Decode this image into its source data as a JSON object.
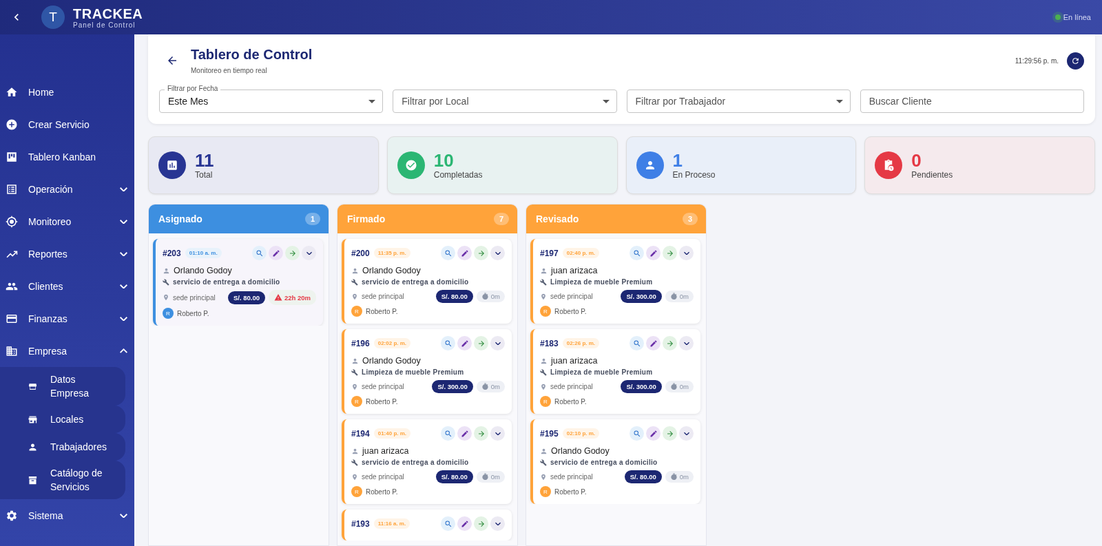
{
  "topbar": {
    "avatar_letter": "T",
    "brand": "TRACKEA",
    "subtitle": "Panel de Control",
    "status": {
      "label": "En línea",
      "online": true
    }
  },
  "sidebar": {
    "items": [
      {
        "label": "Home",
        "kind": "link"
      },
      {
        "label": "Crear Servicio",
        "kind": "link"
      },
      {
        "label": "Tablero Kanban",
        "kind": "link"
      },
      {
        "label": "Operación",
        "kind": "group",
        "expanded": false
      },
      {
        "label": "Monitoreo",
        "kind": "group",
        "expanded": false
      },
      {
        "label": "Reportes",
        "kind": "group",
        "expanded": false
      },
      {
        "label": "Clientes",
        "kind": "group",
        "expanded": false
      },
      {
        "label": "Finanzas",
        "kind": "group",
        "expanded": false
      },
      {
        "label": "Empresa",
        "kind": "group",
        "expanded": true,
        "children": [
          {
            "label": "Datos Empresa"
          },
          {
            "label": "Locales"
          },
          {
            "label": "Trabajadores"
          },
          {
            "label": "Catálogo de Servicios"
          }
        ]
      },
      {
        "label": "Sistema",
        "kind": "group",
        "expanded": false
      }
    ]
  },
  "header": {
    "title": "Tablero de Control",
    "subtitle": "Monitoreo en tiempo real",
    "time": "11:29:56 p. m.",
    "filters": [
      {
        "kind": "select",
        "label": "Filtrar por Fecha",
        "value": "Este Mes"
      },
      {
        "kind": "select",
        "placeholder": "Filtrar por Local"
      },
      {
        "kind": "select",
        "placeholder": "Filtrar por Trabajador"
      },
      {
        "kind": "search",
        "placeholder": "Buscar Cliente"
      }
    ]
  },
  "stats": [
    {
      "value": "11",
      "label": "Total",
      "color": "#283593"
    },
    {
      "value": "10",
      "label": "Completadas",
      "color": "#2bb673"
    },
    {
      "value": "1",
      "label": "En Proceso",
      "color": "#3f7fe6"
    },
    {
      "value": "0",
      "label": "Pendientes",
      "color": "#e53945"
    }
  ],
  "columns": [
    {
      "title": "Asignado",
      "count": "1",
      "color": "#3d8fe0",
      "cards": [
        {
          "id": "#203",
          "time": "01:10 a. m.",
          "client": "Orlando Godoy",
          "service": "servicio de entrega a domicilio",
          "location": "sede principal",
          "price": "S/. 80.00",
          "timer": {
            "kind": "alert",
            "text": "22h 20m"
          },
          "worker_initial": "R",
          "worker": "Roberto P."
        }
      ]
    },
    {
      "title": "Firmado",
      "count": "7",
      "color": "#ffa33a",
      "cards": [
        {
          "id": "#200",
          "time": "11:35 p. m.",
          "client": "Orlando Godoy",
          "service": "servicio de entrega a domicilio",
          "location": "sede principal",
          "price": "S/. 80.00",
          "timer": {
            "kind": "normal",
            "text": "0m"
          },
          "worker_initial": "R",
          "worker": "Roberto P."
        },
        {
          "id": "#196",
          "time": "02:02 p. m.",
          "client": "Orlando Godoy",
          "service": "Limpieza de mueble Premium",
          "location": "sede principal",
          "price": "S/. 300.00",
          "timer": {
            "kind": "normal",
            "text": "0m"
          },
          "worker_initial": "R",
          "worker": "Roberto P."
        },
        {
          "id": "#194",
          "time": "01:40 p. m.",
          "client": "juan arizaca",
          "service": "servicio de entrega a domicilio",
          "location": "sede principal",
          "price": "S/. 80.00",
          "timer": {
            "kind": "normal",
            "text": "0m"
          },
          "worker_initial": "R",
          "worker": "Roberto P."
        },
        {
          "id": "#193",
          "time": "11:16 a. m."
        }
      ]
    },
    {
      "title": "Revisado",
      "count": "3",
      "color": "#ffa33a",
      "cards": [
        {
          "id": "#197",
          "time": "02:40 p. m.",
          "client": "juan arizaca",
          "service": "Limpieza de mueble Premium",
          "location": "sede principal",
          "price": "S/. 300.00",
          "timer": {
            "kind": "normal",
            "text": "0m"
          },
          "worker_initial": "R",
          "worker": "Roberto P."
        },
        {
          "id": "#183",
          "time": "02:26 p. m.",
          "client": "juan arizaca",
          "service": "Limpieza de mueble Premium",
          "location": "sede principal",
          "price": "S/. 300.00",
          "timer": {
            "kind": "normal",
            "text": "0m"
          },
          "worker_initial": "R",
          "worker": "Roberto P."
        },
        {
          "id": "#195",
          "time": "02:10 p. m.",
          "client": "Orlando Godoy",
          "service": "servicio de entrega a domicilio",
          "location": "sede principal",
          "price": "S/. 80.00",
          "timer": {
            "kind": "normal",
            "text": "0m"
          },
          "worker_initial": "R",
          "worker": "Roberto P."
        }
      ]
    }
  ]
}
